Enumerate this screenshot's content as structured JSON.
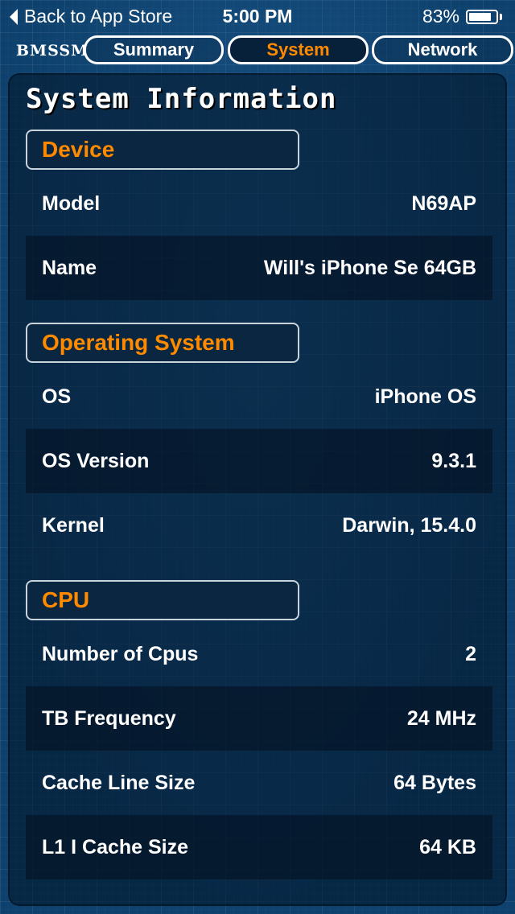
{
  "status_bar": {
    "back_label": "Back to App Store",
    "time": "5:00 PM",
    "battery_percent_text": "83%",
    "battery_level": 0.83
  },
  "tab_bar": {
    "brand": "BMSSM",
    "tabs": [
      {
        "label": "Summary",
        "active": false
      },
      {
        "label": "System",
        "active": true
      },
      {
        "label": "Network",
        "active": false
      }
    ]
  },
  "page": {
    "title": "System Information"
  },
  "sections": [
    {
      "title": "Device",
      "rows": [
        {
          "label": "Model",
          "value": "N69AP"
        },
        {
          "label": "Name",
          "value": "Will's iPhone Se 64GB"
        }
      ]
    },
    {
      "title": "Operating System",
      "rows": [
        {
          "label": "OS",
          "value": "iPhone OS"
        },
        {
          "label": "OS Version",
          "value": "9.3.1"
        },
        {
          "label": "Kernel",
          "value": "Darwin, 15.4.0"
        }
      ]
    },
    {
      "title": "CPU",
      "rows": [
        {
          "label": "Number of Cpus",
          "value": "2"
        },
        {
          "label": "TB Frequency",
          "value": "24 MHz"
        },
        {
          "label": "Cache Line Size",
          "value": "64 Bytes"
        },
        {
          "label": "L1 I Cache Size",
          "value": "64 KB"
        }
      ]
    }
  ],
  "colors": {
    "accent": "#ff8a00",
    "background": "#0e416d"
  }
}
